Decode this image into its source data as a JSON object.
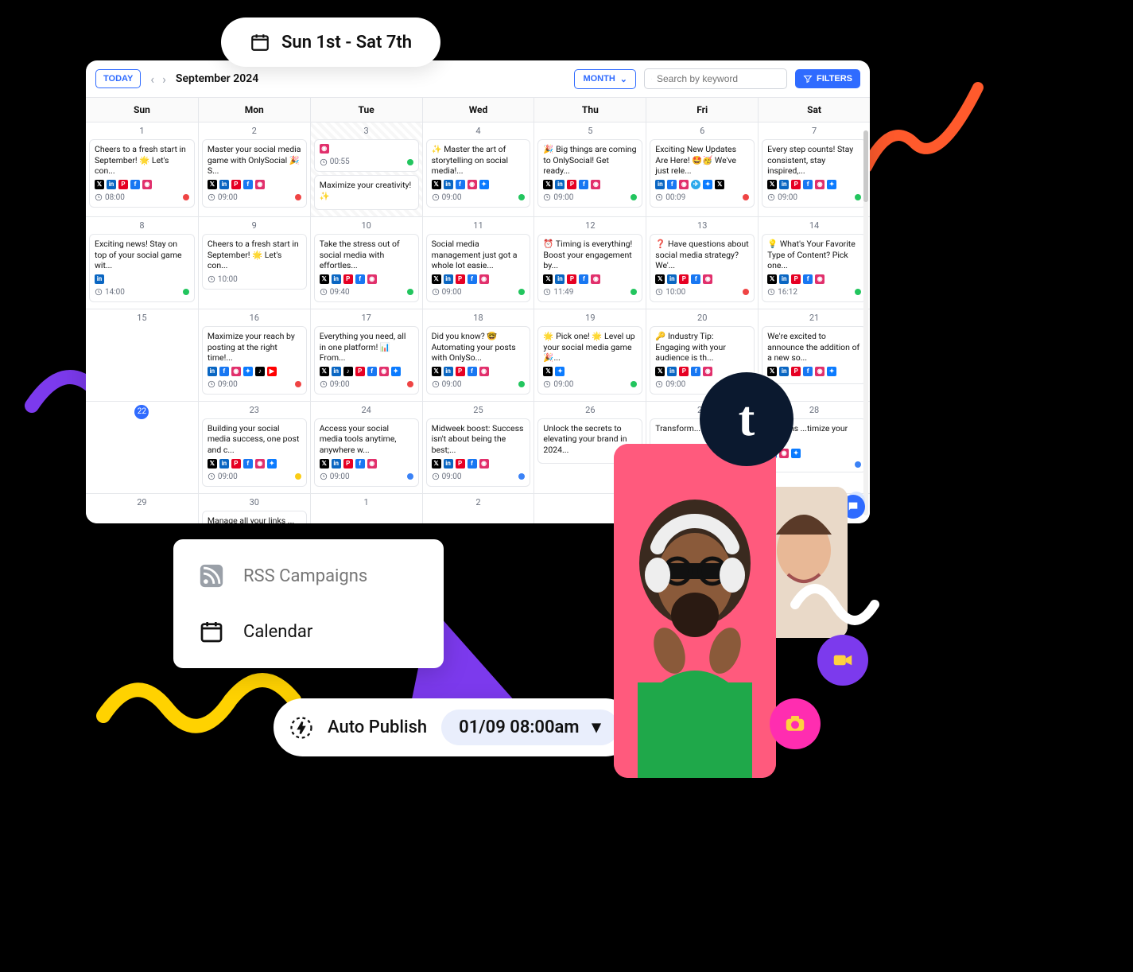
{
  "date_range_label": "Sun 1st - Sat 7th",
  "toolbar": {
    "today": "TODAY",
    "month_title": "September 2024",
    "view": "MONTH",
    "search_placeholder": "Search by keyword",
    "filters": "FILTERS"
  },
  "weekdays": [
    "Sun",
    "Mon",
    "Tue",
    "Wed",
    "Thu",
    "Fri",
    "Sat"
  ],
  "menu": {
    "rss": "RSS Campaigns",
    "calendar": "Calendar"
  },
  "publish": {
    "label": "Auto Publish",
    "value": "01/09 08:00am"
  },
  "tumblr_glyph": "t",
  "add_glyph": "+",
  "weeks": [
    {
      "days": [
        {
          "num": "1",
          "cards": [
            {
              "text": "Cheers to a fresh start in September! 🌟 Let's con...",
              "icons": [
                "x",
                "li",
                "pn",
                "fb",
                "ig"
              ],
              "time": "08:00",
              "dot": "red"
            }
          ]
        },
        {
          "num": "2",
          "cards": [
            {
              "text": "Master your social media game with OnlySocial 🎉 S...",
              "icons": [
                "x",
                "li",
                "pn",
                "fb",
                "ig"
              ],
              "time": "09:00",
              "dot": "red"
            }
          ]
        },
        {
          "num": "3",
          "hatched": true,
          "cards": [
            {
              "text": "",
              "icons": [
                "ig"
              ],
              "time": "00:55",
              "dot": "green",
              "small": true
            },
            {
              "text": "Maximize your creativity! ✨",
              "icons": [],
              "time": "",
              "dot": "",
              "noFoot": true
            }
          ]
        },
        {
          "num": "4",
          "cards": [
            {
              "text": "✨ Master the art of storytelling on social media!...",
              "icons": [
                "x",
                "li",
                "fb",
                "ig",
                "bs"
              ],
              "time": "09:00",
              "dot": "green"
            }
          ]
        },
        {
          "num": "5",
          "cards": [
            {
              "text": "🎉 Big things are coming to OnlySocial! Get ready...",
              "icons": [
                "x",
                "li",
                "pn",
                "fb",
                "ig"
              ],
              "time": "09:00",
              "dot": "green"
            }
          ]
        },
        {
          "num": "6",
          "cards": [
            {
              "text": "Exciting New Updates Are Here! 🤩🥳 We've just rele...",
              "icons": [
                "li",
                "fb",
                "ig",
                "tg",
                "bs",
                "x"
              ],
              "time": "00:09",
              "dot": "red"
            }
          ]
        },
        {
          "num": "7",
          "cards": [
            {
              "text": "Every step counts! Stay consistent, stay inspired,...",
              "icons": [
                "x",
                "li",
                "pn",
                "fb",
                "ig",
                "bs"
              ],
              "time": "09:00",
              "dot": "green"
            }
          ]
        }
      ]
    },
    {
      "days": [
        {
          "num": "8",
          "cards": [
            {
              "text": "Exciting news! Stay on top of your social game wit...",
              "icons": [
                "li"
              ],
              "time": "14:00",
              "dot": "green"
            }
          ]
        },
        {
          "num": "9",
          "cards": [
            {
              "text": "Cheers to a fresh start in September! 🌟 Let's con...",
              "icons": [],
              "time": "10:00",
              "dot": ""
            }
          ]
        },
        {
          "num": "10",
          "cards": [
            {
              "text": "Take the stress out of social media with effortles...",
              "icons": [
                "x",
                "li",
                "pn",
                "fb",
                "ig"
              ],
              "time": "09:40",
              "dot": "green"
            }
          ]
        },
        {
          "num": "11",
          "cards": [
            {
              "text": "Social media management just got a whole lot easie...",
              "icons": [
                "x",
                "li",
                "pn",
                "fb",
                "ig"
              ],
              "time": "09:00",
              "dot": "green"
            }
          ]
        },
        {
          "num": "12",
          "cards": [
            {
              "text": "⏰ Timing is everything! Boost your engagement by...",
              "icons": [
                "x",
                "li",
                "pn",
                "fb",
                "ig"
              ],
              "time": "11:49",
              "dot": "green"
            }
          ]
        },
        {
          "num": "13",
          "cards": [
            {
              "text": "❓ Have questions about social media strategy? We'...",
              "icons": [
                "x",
                "li",
                "pn",
                "fb",
                "ig"
              ],
              "time": "10:00",
              "dot": "red"
            }
          ]
        },
        {
          "num": "14",
          "cards": [
            {
              "text": "💡 What's Your Favorite Type of Content? Pick one...",
              "icons": [
                "x",
                "li",
                "pn",
                "fb",
                "ig"
              ],
              "time": "16:12",
              "dot": "green"
            }
          ]
        }
      ]
    },
    {
      "days": [
        {
          "num": "15",
          "cards": []
        },
        {
          "num": "16",
          "cards": [
            {
              "text": "Maximize your reach by posting at the right time!...",
              "icons": [
                "li",
                "fb",
                "ig",
                "bs",
                "tt",
                "yt"
              ],
              "time": "09:00",
              "dot": "red"
            }
          ]
        },
        {
          "num": "17",
          "cards": [
            {
              "text": "Everything you need, all in one platform! 📊 From...",
              "icons": [
                "x",
                "li",
                "tt",
                "pn",
                "fb",
                "ig",
                "bs"
              ],
              "time": "09:00",
              "dot": "red"
            }
          ]
        },
        {
          "num": "18",
          "cards": [
            {
              "text": "Did you know? 🤓 Automating your posts with OnlySo...",
              "icons": [
                "x",
                "li",
                "pn",
                "fb",
                "ig"
              ],
              "time": "09:00",
              "dot": "green"
            }
          ]
        },
        {
          "num": "19",
          "cards": [
            {
              "text": "🌟 Pick one! 🌟 Level up your social media game 🎉...",
              "icons": [
                "x",
                "bs"
              ],
              "time": "09:00",
              "dot": "green"
            }
          ]
        },
        {
          "num": "20",
          "cards": [
            {
              "text": "🔑 Industry Tip: Engaging with your audience is th...",
              "icons": [
                "x",
                "li",
                "pn",
                "fb",
                "ig"
              ],
              "time": "09:00",
              "dot": "yellow"
            }
          ]
        },
        {
          "num": "21",
          "cards": [
            {
              "text": "We're excited to announce the addition of a new so...",
              "icons": [
                "x",
                "li",
                "pn",
                "fb",
                "ig",
                "bs"
              ],
              "time": "",
              "dot": ""
            }
          ]
        }
      ]
    },
    {
      "days": [
        {
          "num": "22",
          "badge": true,
          "cards": []
        },
        {
          "num": "23",
          "cards": [
            {
              "text": "Building your social media success, one post and c...",
              "icons": [
                "x",
                "li",
                "pn",
                "fb",
                "ig",
                "bs"
              ],
              "time": "09:00",
              "dot": "yellow"
            }
          ]
        },
        {
          "num": "24",
          "cards": [
            {
              "text": "Access your social media tools anytime, anywhere w...",
              "icons": [
                "x",
                "li",
                "pn",
                "fb",
                "ig"
              ],
              "time": "09:00",
              "dot": "blue"
            }
          ]
        },
        {
          "num": "25",
          "cards": [
            {
              "text": "Midweek boost: Success isn't about being the best;...",
              "icons": [
                "x",
                "li",
                "pn",
                "fb",
                "ig"
              ],
              "time": "09:00",
              "dot": "blue"
            }
          ]
        },
        {
          "num": "26",
          "cards": [
            {
              "text": "Unlock the secrets to elevating your brand in 2024...",
              "icons": [],
              "time": "",
              "dot": ""
            }
          ]
        },
        {
          "num": "27",
          "cards": [
            {
              "text": "Transform...",
              "icons": [],
              "time": "",
              "dot": ""
            }
          ]
        },
        {
          "num": "28",
          "cards": [
            {
              "text": "...ssions ...timize your ...d...",
              "icons": [
                "fb",
                "ig",
                "bs"
              ],
              "time": "",
              "dot": "blue"
            }
          ]
        }
      ]
    },
    {
      "days": [
        {
          "num": "29",
          "cards": []
        },
        {
          "num": "30",
          "cards": [
            {
              "text": "Manage all your links ...",
              "icons": [],
              "time": "",
              "dot": "",
              "noFoot": true
            }
          ]
        },
        {
          "num": "1",
          "cards": []
        },
        {
          "num": "2",
          "cards": []
        },
        {
          "num": "",
          "cards": []
        },
        {
          "num": "",
          "cards": []
        },
        {
          "num": "",
          "cards": []
        }
      ]
    }
  ]
}
